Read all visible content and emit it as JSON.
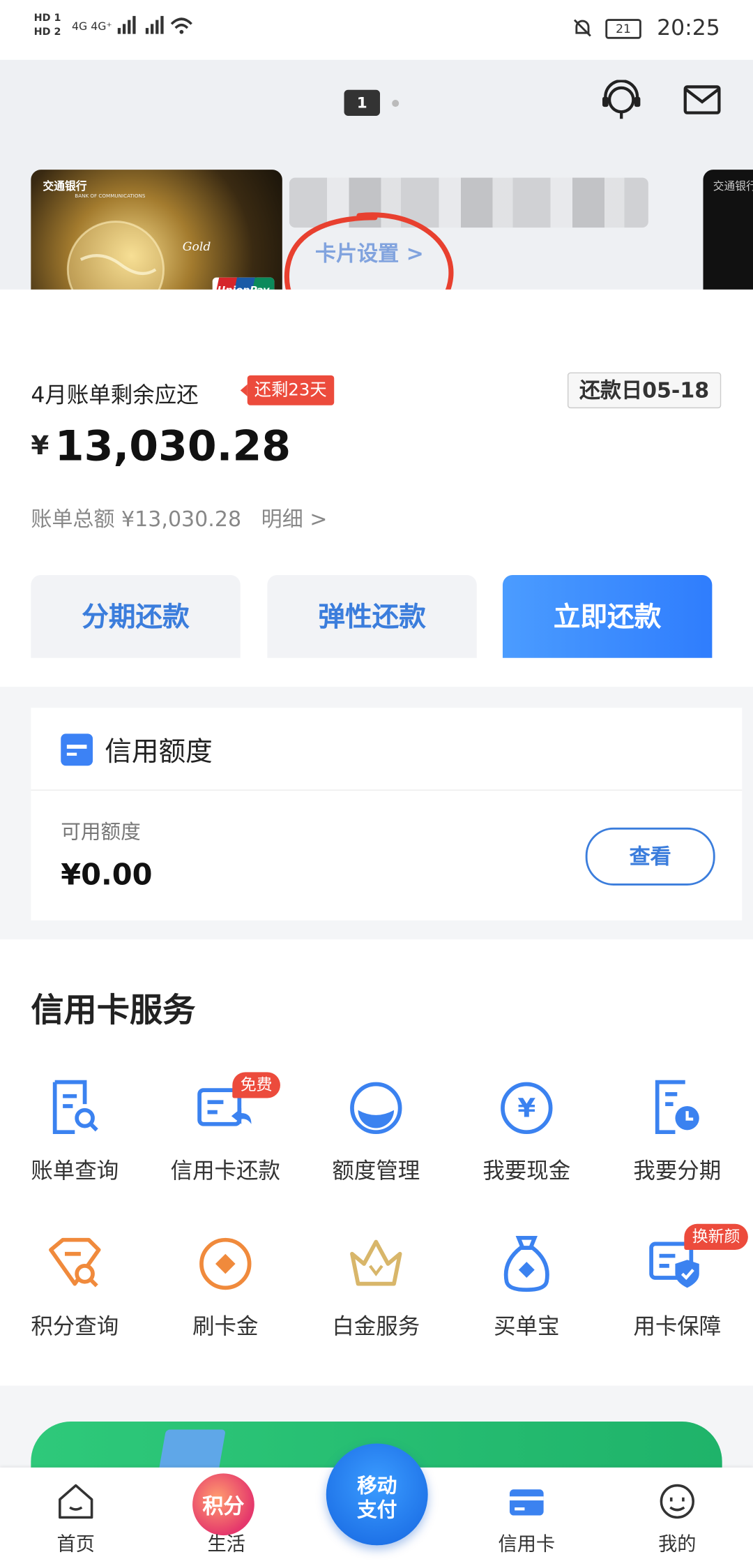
{
  "status_bar": {
    "sim1": "HD 1",
    "sim2": "HD 2",
    "network": "4G 4G⁺",
    "battery": "21",
    "time": "20:25"
  },
  "header": {
    "page_indicator": "1",
    "card_brand": "交通银行",
    "card_sub": "BANK OF COMMUNICATIONS",
    "card_level": "Gold",
    "unionpay": "UnionPay",
    "unionpay_cn": "银联",
    "card_settings": "卡片设置 >"
  },
  "bill": {
    "title": "4月账单剩余应还",
    "days_left": "还剩23天",
    "due_date": "还款日05-18",
    "currency": "¥",
    "amount": "13,030.28",
    "total_label": "账单总额 ¥13,030.28",
    "detail_link": "明细 >"
  },
  "actions": {
    "installment": "分期还款",
    "flexible": "弹性还款",
    "pay_now": "立即还款"
  },
  "credit_limit": {
    "title": "信用额度",
    "available_label": "可用额度",
    "available_value": "¥0.00",
    "view_button": "查看"
  },
  "services": {
    "title": "信用卡服务",
    "items": [
      {
        "label": "账单查询",
        "icon": "bill-search-icon"
      },
      {
        "label": "信用卡还款",
        "icon": "card-repay-icon",
        "badge": "免费"
      },
      {
        "label": "额度管理",
        "icon": "limit-gauge-icon"
      },
      {
        "label": "我要现金",
        "icon": "cash-yen-icon"
      },
      {
        "label": "我要分期",
        "icon": "installment-clock-icon"
      },
      {
        "label": "积分查询",
        "icon": "points-tag-icon"
      },
      {
        "label": "刷卡金",
        "icon": "swipe-coin-icon"
      },
      {
        "label": "白金服务",
        "icon": "crown-icon"
      },
      {
        "label": "买单宝",
        "icon": "money-bag-icon"
      },
      {
        "label": "用卡保障",
        "icon": "card-shield-icon",
        "badge": "换新颜"
      }
    ]
  },
  "nav": {
    "home": "首页",
    "life": "生活",
    "points": "积分",
    "mobile_pay_line1": "移动",
    "mobile_pay_line2": "支付",
    "card": "信用卡",
    "mine": "我的"
  },
  "colors": {
    "primary": "#3b7ddc",
    "badge_red": "#ec4b3c",
    "banner_green": "#2ec97a",
    "icon_orange": "#f08a3c"
  }
}
